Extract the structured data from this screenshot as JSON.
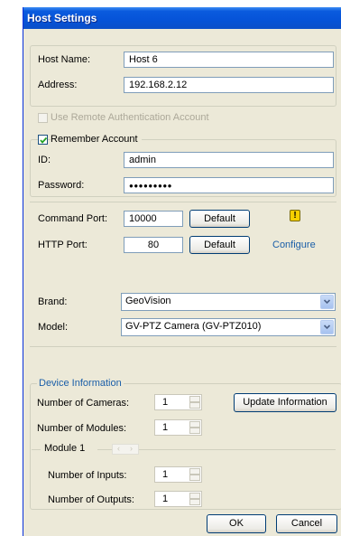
{
  "window": {
    "title": "Host Settings"
  },
  "host": {
    "name_label": "Host Name:",
    "name_value": "Host 6",
    "address_label": "Address:",
    "address_value": "192.168.2.12"
  },
  "auth": {
    "use_remote_label": "Use Remote Authentication Account",
    "remember_label": "Remember Account",
    "id_label": "ID:",
    "id_value": "admin",
    "password_label": "Password:",
    "password_value": "●●●●●●●●●"
  },
  "ports": {
    "command_label": "Command Port:",
    "command_value": "10000",
    "http_label": "HTTP Port:",
    "http_value": "80",
    "default_label": "Default",
    "configure_label": "Configure"
  },
  "device": {
    "brand_label": "Brand:",
    "brand_value": "GeoVision",
    "model_label": "Model:",
    "model_value": "GV-PTZ Camera (GV-PTZ010)"
  },
  "device_info": {
    "legend": "Device Information",
    "cameras_label": "Number of Cameras:",
    "cameras_value": "1",
    "update_label": "Update Information",
    "modules_label": "Number of Modules:",
    "modules_value": "1",
    "module_label": "Module 1",
    "inputs_label": "Number of Inputs:",
    "inputs_value": "1",
    "outputs_label": "Number of Outputs:",
    "outputs_value": "1"
  },
  "footer": {
    "ok_label": "OK",
    "cancel_label": "Cancel"
  },
  "colors": {
    "titlebar": "#0653d8",
    "face": "#ece9d8",
    "link": "#1a5ea8",
    "warning": "#f5d000"
  }
}
